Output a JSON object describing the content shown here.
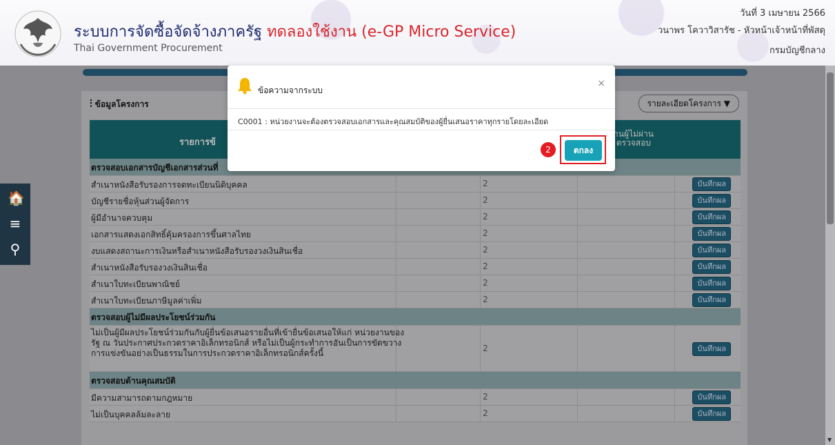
{
  "header": {
    "title_main": "ระบบการจัดซื้อจัดจ้างภาครัฐ",
    "title_trial": "ทดลองใช้งาน (e-GP Micro Service)",
    "subtitle": "Thai Government Procurement",
    "date": "วันที่ 3 เมษายน 2566",
    "user": "วนาพร โควาวิสารัช - หัวหน้าเจ้าหน้าที่พัสดุ",
    "department": "กรมบัญชีกลาง",
    "logo_icon": "garuda-emblem-icon"
  },
  "panel": {
    "title": "ข้อมูลโครงการ",
    "detail_button": "รายละเอียดโครงการ",
    "header_col1": "รายการข้",
    "header_col2_line1": "านผู้ไม่ผ่าน",
    "header_col2_line2": "ตรวจสอบ"
  },
  "table": {
    "sections": [
      {
        "title": "ตรวจสอบเอกสารบัญชีเอกสารส่วนที่",
        "rows": [
          {
            "label": "สำเนาหนังสือรับรองการจดทะเบียนนิติบุคคล",
            "count": "2",
            "action": "บันทึกผล"
          },
          {
            "label": "บัญชีรายชื่อหุ้นส่วนผู้จัดการ",
            "count": "2",
            "action": "บันทึกผล"
          },
          {
            "label": "ผู้มีอำนาจควบคุม",
            "count": "2",
            "action": "บันทึกผล"
          },
          {
            "label": "เอกสารแสดงเอกสิทธิ์คุ้มครองการขึ้นศาลไทย",
            "count": "2",
            "action": "บันทึกผล"
          },
          {
            "label": "งบแสดงสถานะการเงินหรือสำเนาหนังสือรับรองวงเงินสินเชื่อ",
            "count": "2",
            "action": "บันทึกผล"
          },
          {
            "label": "สำเนาหนังสือรับรองวงเงินสินเชื่อ",
            "count": "2",
            "action": "บันทึกผล"
          },
          {
            "label": "สำเนาใบทะเบียนพาณิชย์",
            "count": "2",
            "action": "บันทึกผล"
          },
          {
            "label": "สำเนาใบทะเบียนภาษีมูลค่าเพิ่ม",
            "count": "2",
            "action": "บันทึกผล"
          }
        ]
      },
      {
        "title": "ตรวจสอบผู้ไม่มีผลประโยชน์ร่วมกัน",
        "rows": [
          {
            "label": "ไม่เป็นผู้มีผลประโยชน์ร่วมกันกับผู้ยื่นข้อเสนอรายอื่นที่เข้ายื่นข้อเสนอให้แก่ หน่วยงานของรัฐ ณ วันประกาศประกวดราคาอิเล็กทรอนิกส์ หรือไม่เป็นผู้กระทำการอันเป็นการขัดขวางการแข่งขันอย่างเป็นธรรมในการประกวดราคาอิเล็กทรอนิกส์ครั้งนี้",
            "count": "2",
            "action": "บันทึกผล"
          }
        ]
      },
      {
        "title": "ตรวจสอบด้านคุณสมบัติ",
        "rows": [
          {
            "label": "มีความสามารถตามกฎหมาย",
            "count": "2",
            "action": "บันทึกผล"
          },
          {
            "label": "ไม่เป็นบุคคลล้มละลาย",
            "count": "2",
            "action": "บันทึกผล"
          }
        ]
      }
    ]
  },
  "sidenav": {
    "items": [
      {
        "icon": "home-icon",
        "glyph": "🏠"
      },
      {
        "icon": "menu-icon",
        "glyph": "≡"
      },
      {
        "icon": "search-icon",
        "glyph": "⚲"
      }
    ]
  },
  "modal": {
    "title": "ข้อความจากระบบ",
    "close": "×",
    "message": "C0001 : หน่วยงานจะต้องตรวจสอบเอกสารและคุณสมบัติของผู้ยื่นเสนอราคาทุกรายโดยละเอียด",
    "ok_label": "ตกลง",
    "step_badge": "2",
    "bell_color": "#f5b400",
    "ok_color": "#17a2b8",
    "highlight_color": "#e01e24"
  }
}
